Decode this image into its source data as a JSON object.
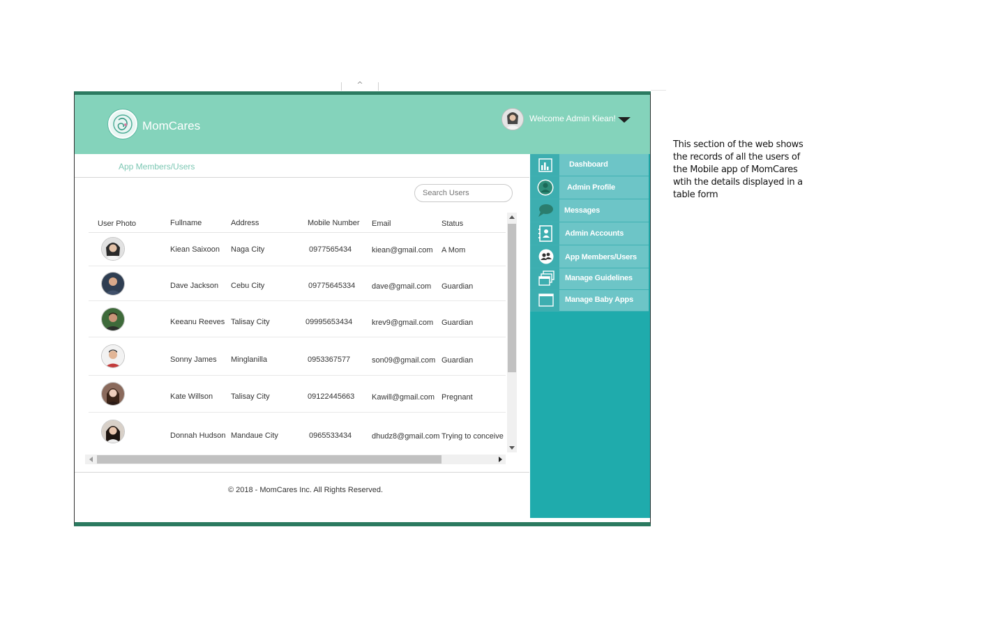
{
  "app": {
    "name": "MomCares"
  },
  "header": {
    "welcome": "Welcome Admin Kiean!"
  },
  "breadcrumb": "App Members/Users",
  "search": {
    "placeholder": "Search Users"
  },
  "table": {
    "columns": [
      "User Photo",
      "Fullname",
      "Address",
      "Mobile Number",
      "Email",
      "Status"
    ],
    "rows": [
      {
        "fullname": "Kiean Saixoon",
        "address": "Naga City",
        "mobile": "0977565434",
        "email": "kiean@gmail.com",
        "status": "A Mom"
      },
      {
        "fullname": "Dave Jackson",
        "address": "Cebu City",
        "mobile": "09775645334",
        "email": "dave@gmail.com",
        "status": "Guardian"
      },
      {
        "fullname": "Keeanu Reeves",
        "address": "Talisay City",
        "mobile": "09995653434",
        "email": "krev9@gmail.com",
        "status": "Guardian"
      },
      {
        "fullname": "Sonny James",
        "address": "Minglanilla",
        "mobile": "0953367577",
        "email": "son09@gmail.com",
        "status": "Guardian"
      },
      {
        "fullname": "Kate Willson",
        "address": "Talisay City",
        "mobile": "09122445663",
        "email": "Kawill@gmail.com",
        "status": "Pregnant"
      },
      {
        "fullname": "Donnah Hudson",
        "address": "Mandaue City",
        "mobile": "0965533434",
        "email": "dhudz8@gmail.com",
        "status": "Trying to conceive"
      }
    ]
  },
  "sidebar": {
    "items": [
      {
        "label": "Dashboard",
        "icon": "bar-chart-icon"
      },
      {
        "label": "Admin Profile",
        "icon": "user-icon"
      },
      {
        "label": "Messages",
        "icon": "chat-icon"
      },
      {
        "label": "Admin Accounts",
        "icon": "contacts-icon"
      },
      {
        "label": "App Members/Users",
        "icon": "group-icon"
      },
      {
        "label": "Manage Guidelines",
        "icon": "stacked-windows-icon"
      },
      {
        "label": "Manage Baby Apps",
        "icon": "window-icon"
      }
    ]
  },
  "footer": "© 2018 - MomCares Inc. All Rights Reserved.",
  "annotation": "This section of the web shows the records of all the users of the Mobile app of MomCares wtih the details displayed in a table form",
  "colors": {
    "header": "#84d3bb",
    "frame_accent": "#2b7a60",
    "sidebar_bg": "#1fabac",
    "sidebar_item": "#6dc5c7",
    "breadcrumb_text": "#7cc7b3"
  }
}
